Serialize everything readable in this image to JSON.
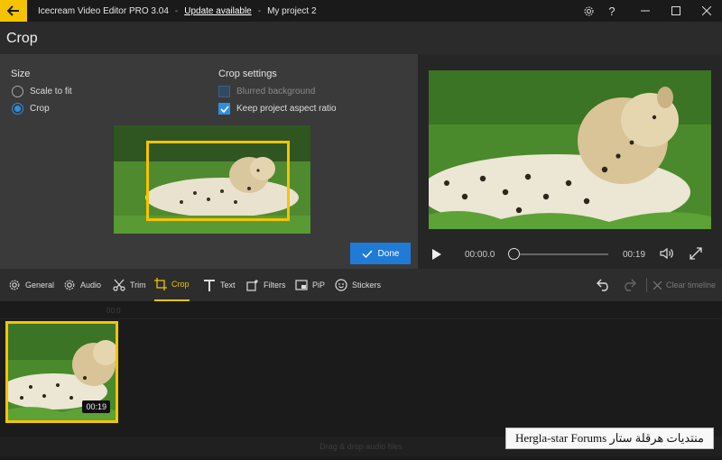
{
  "titlebar": {
    "app_title": "Icecream Video Editor PRO 3.04",
    "separator": "-",
    "update_link": "Update available",
    "project_name": "My project 2"
  },
  "header": {
    "title": "Crop"
  },
  "size": {
    "label": "Size",
    "options": [
      {
        "label": "Scale to fit",
        "selected": false
      },
      {
        "label": "Crop",
        "selected": true
      }
    ]
  },
  "crop_settings": {
    "label": "Crop settings",
    "blurred_background": {
      "label": "Blurred background",
      "checked": false,
      "enabled": false
    },
    "keep_aspect": {
      "label": "Keep project aspect ratio",
      "checked": true,
      "enabled": true
    }
  },
  "done_button": {
    "label": "Done"
  },
  "player": {
    "current_time": "00:00.0",
    "end_time": "00:19",
    "progress": 0
  },
  "toolbar": {
    "tools": [
      {
        "label": "General",
        "icon": "gear-icon"
      },
      {
        "label": "Audio",
        "icon": "gear-icon"
      },
      {
        "label": "Trim",
        "icon": "scissors-icon"
      },
      {
        "label": "Crop",
        "icon": "crop-icon",
        "active": true
      },
      {
        "label": "Text",
        "icon": "text-icon"
      },
      {
        "label": "Filters",
        "icon": "filters-icon"
      },
      {
        "label": "PiP",
        "icon": "pip-icon"
      },
      {
        "label": "Stickers",
        "icon": "sticker-icon"
      }
    ],
    "clear_timeline": "Clear timeline"
  },
  "timeline": {
    "ruler_label": "00:0",
    "clip_duration": "00:19",
    "audio_hint": "Drag & drop audio files"
  },
  "watermark": {
    "text": "Hergla-star Forums منتديات هرقلة ستار"
  },
  "colors": {
    "accent": "#f5c400",
    "primary": "#1f7bd6"
  }
}
